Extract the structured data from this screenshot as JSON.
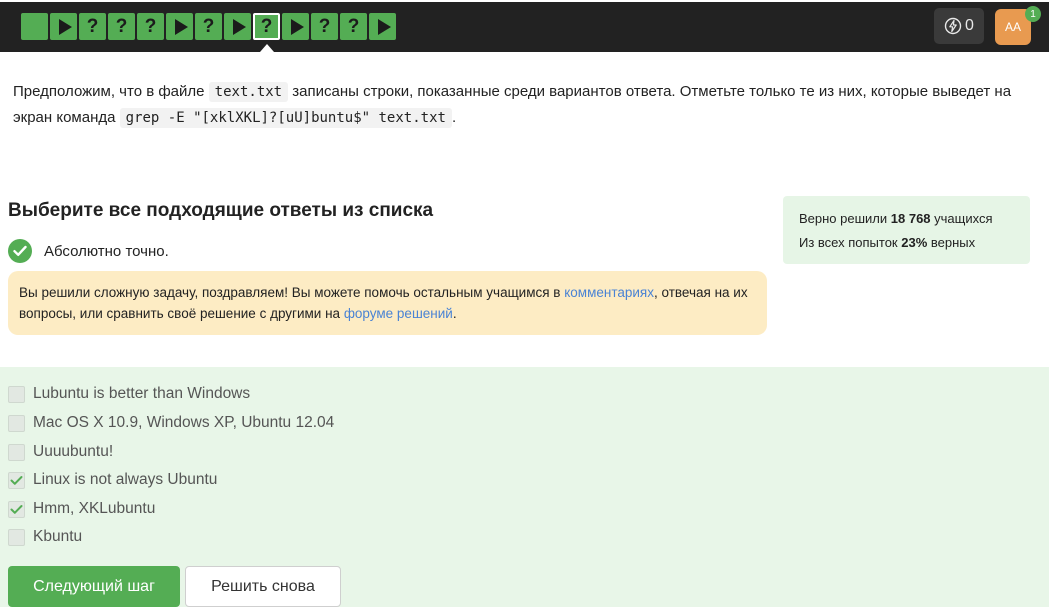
{
  "topbar": {
    "steps": [
      {
        "type": "blank"
      },
      {
        "type": "play"
      },
      {
        "type": "question",
        "label": "?"
      },
      {
        "type": "question",
        "label": "?"
      },
      {
        "type": "question",
        "label": "?"
      },
      {
        "type": "play"
      },
      {
        "type": "question",
        "label": "?"
      },
      {
        "type": "play"
      },
      {
        "type": "question",
        "label": "?",
        "active": true
      },
      {
        "type": "play"
      },
      {
        "type": "question",
        "label": "?"
      },
      {
        "type": "question",
        "label": "?"
      },
      {
        "type": "play"
      }
    ],
    "energy_count": "0",
    "avatar_initials": "AA",
    "notification_count": "1"
  },
  "question": {
    "part1": "Предположим, что в файле ",
    "file_code": "text.txt",
    "part2": " записаны строки, показанные среди вариантов ответа. Отметьте только те из них, которые выведет на экран команда ",
    "command_code": "grep -E \"[xklXKL]?[uU]buntu$\" text.txt",
    "part3": "."
  },
  "heading": "Выберите все подходящие ответы из списка",
  "verdict": "Абсолютно точно.",
  "hint": {
    "text1": "Вы решили сложную задачу, поздравляем! Вы можете помочь остальным учащимся в ",
    "link1": "комментариях",
    "text2": ", отвечая на их вопросы, или сравнить своё решение с другими на ",
    "link2": "форуме решений",
    "text3": "."
  },
  "stats": {
    "line1_prefix": "Верно решили ",
    "solved_count": "18 768",
    "line1_suffix": " учащихся",
    "line2_prefix": "Из всех попыток ",
    "percent": "23%",
    "line2_suffix": " верных"
  },
  "options": [
    {
      "label": "Lubuntu is better than Windows",
      "checked": false
    },
    {
      "label": "Mac OS X 10.9, Windows XP, Ubuntu 12.04",
      "checked": false
    },
    {
      "label": "Uuuubuntu!",
      "checked": false
    },
    {
      "label": "Linux is not always Ubuntu",
      "checked": true
    },
    {
      "label": "Hmm, XKLubuntu",
      "checked": true
    },
    {
      "label": "Kbuntu",
      "checked": false
    }
  ],
  "buttons": {
    "next": "Следующий шаг",
    "retry": "Решить снова"
  },
  "colors": {
    "accent": "#54ad54",
    "topbar": "#222222",
    "hint_bg": "#fdecc4",
    "options_bg": "#e8f6e8",
    "link": "#4a83d4"
  }
}
